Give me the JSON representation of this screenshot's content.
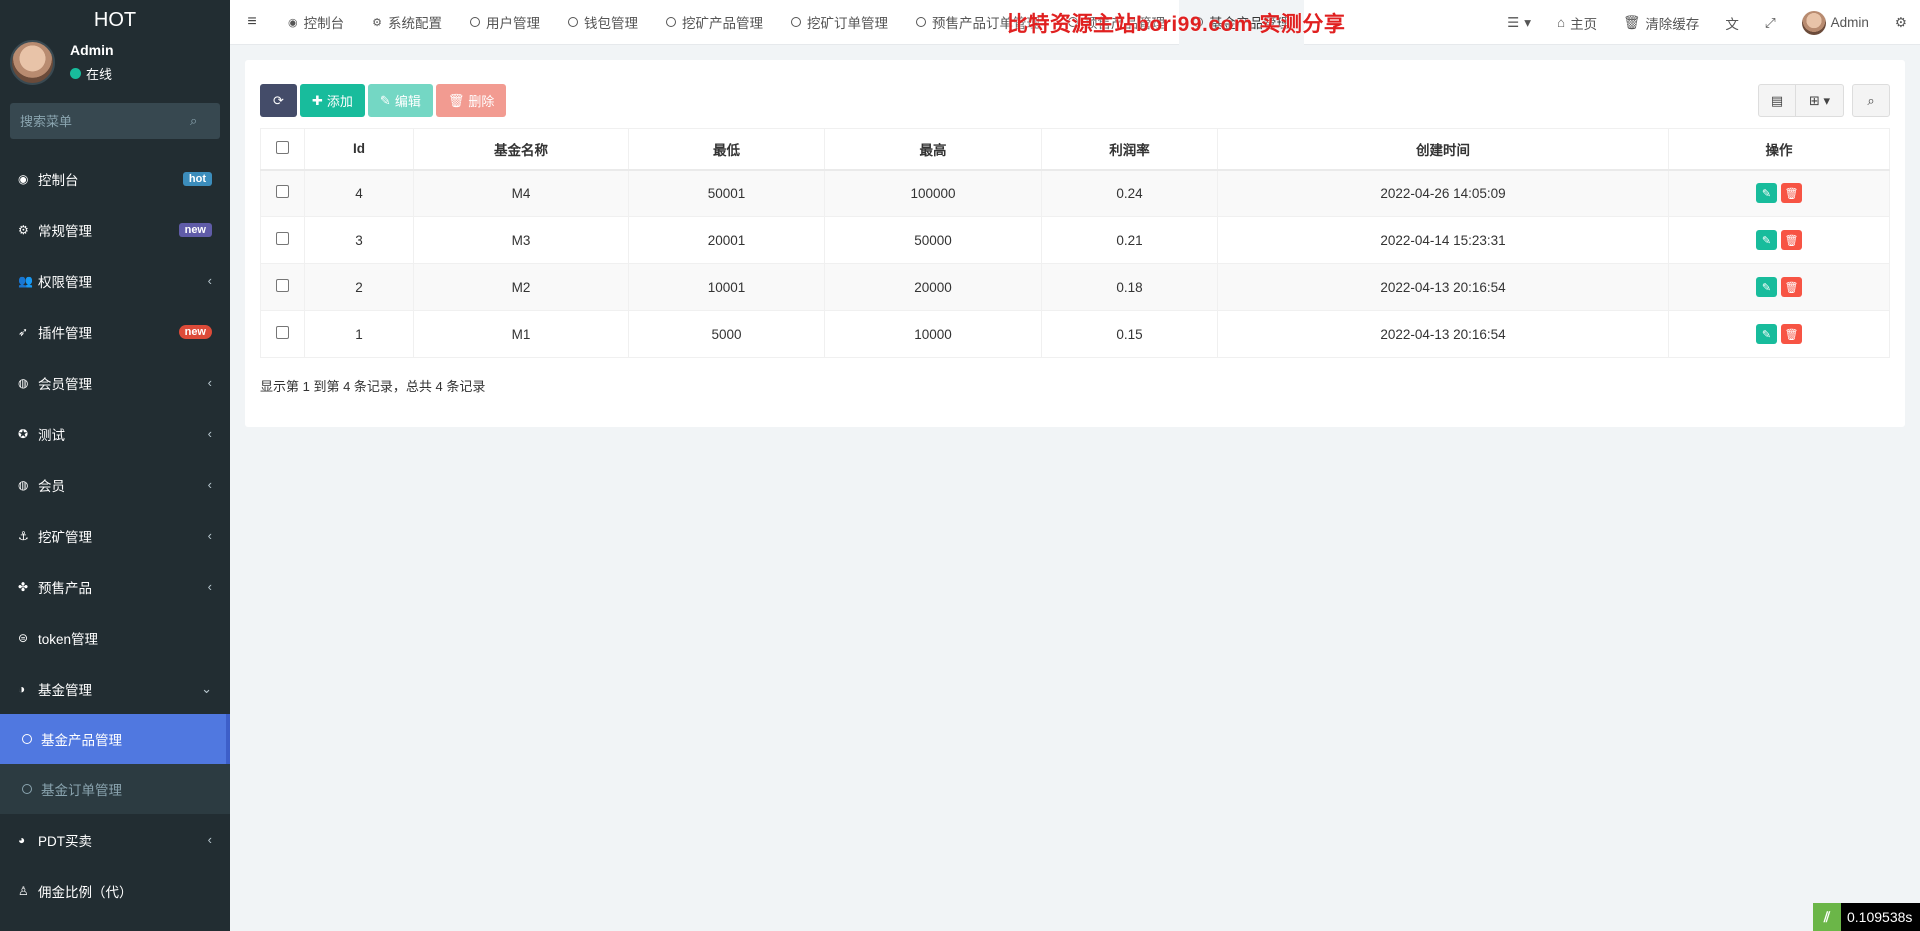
{
  "sidebar": {
    "logo": "HOT",
    "user": {
      "name": "Admin",
      "status": "在线"
    },
    "search_placeholder": "搜索菜单",
    "items": [
      {
        "label": "控制台",
        "icon": "dashboard-icon",
        "glyph": "◉",
        "badge": "hot"
      },
      {
        "label": "常规管理",
        "icon": "cogs-icon",
        "glyph": "⚙",
        "badge": "new"
      },
      {
        "label": "权限管理",
        "icon": "group-icon",
        "glyph": "👥",
        "chevron": "‹"
      },
      {
        "label": "插件管理",
        "icon": "rocket-icon",
        "glyph": "➶",
        "badge": "new"
      },
      {
        "label": "会员管理",
        "icon": "user-circle-icon",
        "glyph": "◍",
        "chevron": "‹"
      },
      {
        "label": "测试",
        "icon": "medal-icon",
        "glyph": "✪",
        "chevron": "‹"
      },
      {
        "label": "会员",
        "icon": "user-circle-icon",
        "glyph": "◍",
        "chevron": "‹"
      },
      {
        "label": "挖矿管理",
        "icon": "anchor-icon",
        "glyph": "⚓",
        "chevron": "‹"
      },
      {
        "label": "预售产品",
        "icon": "product-icon",
        "glyph": "✤",
        "chevron": "‹"
      },
      {
        "label": "token管理",
        "icon": "token-icon",
        "glyph": "⊜"
      },
      {
        "label": "基金管理",
        "icon": "adjust-icon",
        "glyph": "◑",
        "chevron": "⌄"
      }
    ],
    "subitems": [
      {
        "label": "基金产品管理"
      },
      {
        "label": "基金订单管理"
      }
    ],
    "items_after": [
      {
        "label": "PDT买卖",
        "icon": "compass-icon",
        "glyph": "◕",
        "chevron": "‹"
      },
      {
        "label": "佣金比例（代）",
        "icon": "child-icon",
        "glyph": "♙"
      }
    ]
  },
  "navbar": {
    "tabs": [
      {
        "label": "控制台",
        "glyph": "◉"
      },
      {
        "label": "系统配置",
        "glyph": "⚙"
      },
      {
        "label": "用户管理"
      },
      {
        "label": "钱包管理"
      },
      {
        "label": "挖矿产品管理"
      },
      {
        "label": "挖矿订单管理"
      },
      {
        "label": "预售产品订单管理"
      },
      {
        "label": "预售产品管理"
      },
      {
        "label": "基金产品管理"
      }
    ],
    "right": {
      "home": "主页",
      "clear_cache": "清除缓存",
      "user": "Admin"
    },
    "watermark": "比特资源主站bori99.com 实测分享"
  },
  "toolbar": {
    "add": "添加",
    "edit": "编辑",
    "delete": "删除"
  },
  "table": {
    "columns": [
      "Id",
      "基金名称",
      "最低",
      "最高",
      "利润率",
      "创建时间",
      "操作"
    ],
    "rows": [
      {
        "id": "4",
        "name": "M4",
        "min": "50001",
        "max": "100000",
        "rate": "0.24",
        "created": "2022-04-26 14:05:09"
      },
      {
        "id": "3",
        "name": "M3",
        "min": "20001",
        "max": "50000",
        "rate": "0.21",
        "created": "2022-04-14 15:23:31"
      },
      {
        "id": "2",
        "name": "M2",
        "min": "10001",
        "max": "20000",
        "rate": "0.18",
        "created": "2022-04-13 20:16:54"
      },
      {
        "id": "1",
        "name": "M1",
        "min": "5000",
        "max": "10000",
        "rate": "0.15",
        "created": "2022-04-13 20:16:54"
      }
    ]
  },
  "pagination_text": "显示第 1 到第 4 条记录，总共 4 条记录",
  "timer": "0.109538s",
  "colors": {
    "primary": "#18bc9c",
    "danger": "#f75444",
    "sidebar": "#222d32",
    "active": "#5078e0"
  }
}
